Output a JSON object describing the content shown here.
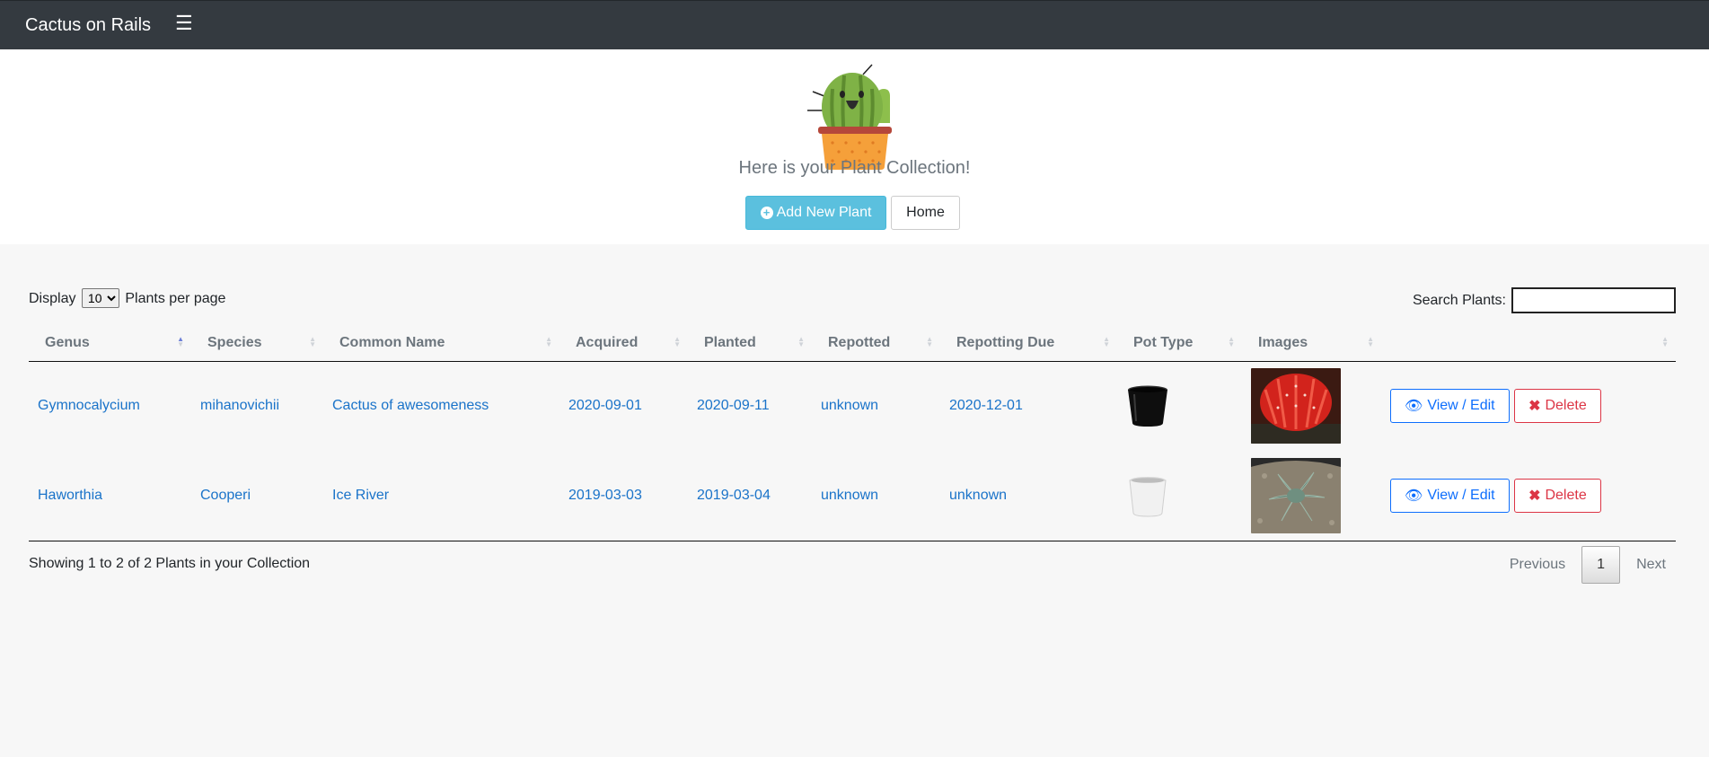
{
  "navbar": {
    "brand": "Cactus on Rails",
    "menu_icon": "hamburger-icon",
    "bg": "#343a40"
  },
  "hero": {
    "text": "Here is your Plant Collection!",
    "add_button": "Add New Plant",
    "home_button": "Home",
    "accent": "#5bc0de"
  },
  "controls": {
    "display_label": "Display",
    "per_page_value": "10",
    "per_page_suffix": "Plants per page",
    "search_label": "Search Plants:",
    "search_value": ""
  },
  "table": {
    "columns": [
      "Genus",
      "Species",
      "Common Name",
      "Acquired",
      "Planted",
      "Repotted",
      "Repotting Due",
      "Pot Type",
      "Images",
      ""
    ],
    "sorted_column": "Genus",
    "rows": [
      {
        "genus": "Gymnocalycium",
        "species": "mihanovichii",
        "common_name": "Cactus of awesomeness",
        "acquired": "2020-09-01",
        "planted": "2020-09-11",
        "repotted": "unknown",
        "repotting_due": "2020-12-01",
        "pot": "black-pot",
        "image": "red-cactus-photo",
        "view_label": "View / Edit",
        "delete_label": "Delete"
      },
      {
        "genus": "Haworthia",
        "species": "Cooperi",
        "common_name": "Ice River",
        "acquired": "2019-03-03",
        "planted": "2019-03-04",
        "repotted": "unknown",
        "repotting_due": "unknown",
        "pot": "white-pot",
        "image": "haworthia-photo",
        "view_label": "View / Edit",
        "delete_label": "Delete"
      }
    ]
  },
  "footer": {
    "info": "Showing 1 to 2 of 2 Plants in your Collection",
    "previous": "Previous",
    "current_page": "1",
    "next": "Next"
  }
}
